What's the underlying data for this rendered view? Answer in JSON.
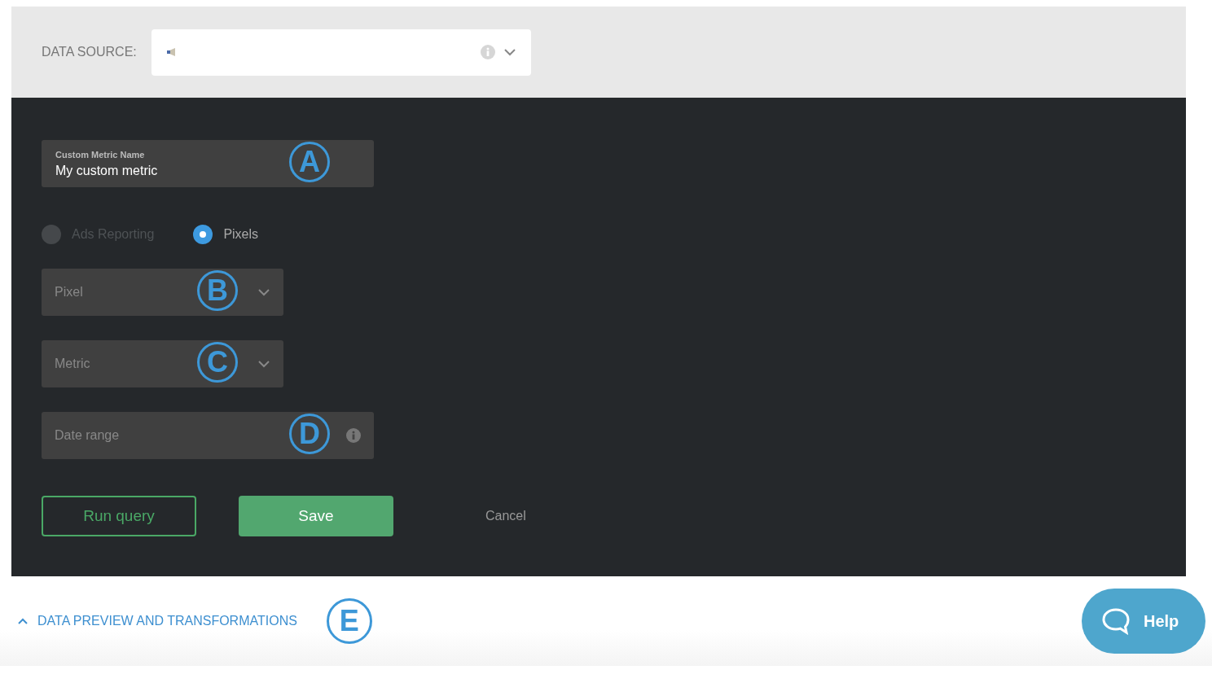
{
  "data_source": {
    "label": "DATA SOURCE:"
  },
  "form": {
    "name_field": {
      "label": "Custom Metric Name",
      "value": "My custom metric",
      "callout": "A"
    },
    "source_options": [
      {
        "label": "Ads Reporting",
        "selected": false,
        "disabled": true
      },
      {
        "label": "Pixels",
        "selected": true,
        "disabled": false
      }
    ],
    "pixel_select": {
      "placeholder": "Pixel",
      "callout": "B"
    },
    "metric_select": {
      "placeholder": "Metric",
      "callout": "C"
    },
    "date_field": {
      "placeholder": "Date range",
      "callout": "D"
    },
    "buttons": [
      {
        "label": "Run query",
        "kind": "outline"
      },
      {
        "label": "Save",
        "kind": "primary"
      },
      {
        "label": "Cancel",
        "kind": "text"
      }
    ]
  },
  "preview_toggle": {
    "label": "DATA PREVIEW AND TRANSFORMATIONS",
    "expanded": true,
    "callout": "E"
  },
  "help_button": {
    "label": "Help"
  }
}
